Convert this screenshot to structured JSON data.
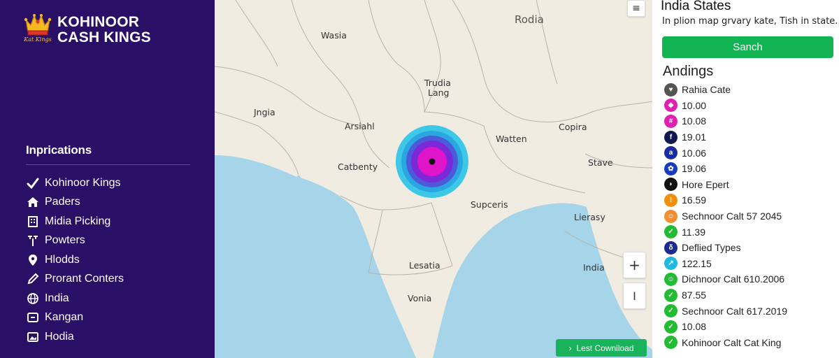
{
  "brand": {
    "name_line1": "KOHINOOR",
    "name_line2": "CASH KINGS",
    "crown_caption": "Kat Kings"
  },
  "sidebar": {
    "section_title": "Inprications",
    "items": [
      {
        "label": "Kohinoor Kings",
        "icon": "check-icon"
      },
      {
        "label": "Paders",
        "icon": "home-icon"
      },
      {
        "label": "Midia Picking",
        "icon": "building-icon"
      },
      {
        "label": "Powters",
        "icon": "tools-icon"
      },
      {
        "label": "Hlodds",
        "icon": "location-pin-icon"
      },
      {
        "label": "Prorant Conters",
        "icon": "pencil-icon"
      },
      {
        "label": "India",
        "icon": "globe-icon"
      },
      {
        "label": "Kangan",
        "icon": "link-icon"
      },
      {
        "label": "Hodia",
        "icon": "image-icon"
      }
    ]
  },
  "map": {
    "labels": {
      "rodia": "Rodia",
      "wasia": "Wasia",
      "trudia": "Trudia",
      "lang": "Lang",
      "jngia": "Jngia",
      "arsiahl": "Arsiahl",
      "watten": "Watten",
      "copira": "Copira",
      "catbenty": "Catbenty",
      "stave": "Stave",
      "supceris": "Supceris",
      "lierasy": "Lierasy",
      "lesatia": "Lesatia",
      "india": "India",
      "vonia": "Vonia"
    },
    "zoom_in": "+",
    "zoom_out": "I",
    "menu": "≡",
    "download_label": "Lest Cowniload",
    "land_color": "#f1ece2",
    "water_color": "#a6d5ea"
  },
  "panel": {
    "title": "India States",
    "subtitle": "In plion map grvary kate, Tish in state.",
    "search_label": "Sanch",
    "findings_title": "Andings",
    "findings": [
      {
        "label": "Rahia Cate",
        "color": "#555555",
        "glyph": "♥"
      },
      {
        "label": "10.00",
        "color": "#e020b0",
        "glyph": "◆"
      },
      {
        "label": "10.08",
        "color": "#e020b0",
        "glyph": "#"
      },
      {
        "label": "19.01",
        "color": "#101850",
        "glyph": "f"
      },
      {
        "label": "10.06",
        "color": "#1a2aa0",
        "glyph": "a"
      },
      {
        "label": "19.06",
        "color": "#1a3ac0",
        "glyph": "✿"
      },
      {
        "label": "Hore Epert",
        "color": "#111111",
        "glyph": "◗"
      },
      {
        "label": "16.59",
        "color": "#f09010",
        "glyph": "!"
      },
      {
        "label": "Sechnoor Calt 57 2045",
        "color": "#f09030",
        "glyph": "☺"
      },
      {
        "label": "11.39",
        "color": "#22bb33",
        "glyph": "✓"
      },
      {
        "label": "Deflied Types",
        "color": "#1a2a90",
        "glyph": "δ"
      },
      {
        "label": "122.15",
        "color": "#20b8e0",
        "glyph": "↗"
      },
      {
        "label": "Dichnoor Calt 610.2006",
        "color": "#22bb33",
        "glyph": "☺"
      },
      {
        "label": "87.55",
        "color": "#22bb33",
        "glyph": "✓"
      },
      {
        "label": "Sechnoor Calt 617.2019",
        "color": "#22bb33",
        "glyph": "✓"
      },
      {
        "label": "10.08",
        "color": "#22bb33",
        "glyph": "✓"
      },
      {
        "label": "Kohinoor Calt Cat King",
        "color": "#22bb33",
        "glyph": "✓"
      }
    ]
  },
  "colors": {
    "sidebar_bg": "#2a0f66",
    "accent_green": "#12b353"
  }
}
